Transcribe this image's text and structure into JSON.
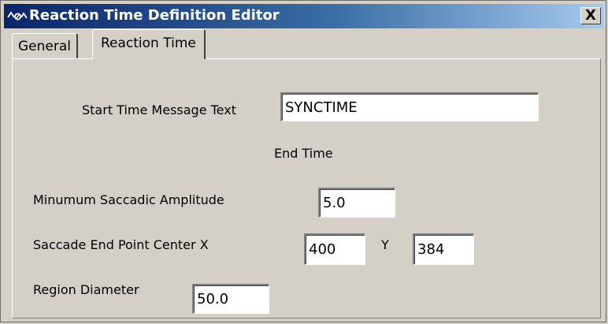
{
  "window": {
    "title": "Reaction Time Definition Editor",
    "close_label": "X",
    "title_gradient": [
      "#0a246a",
      "#a6caf0"
    ]
  },
  "tabs": [
    {
      "label": "General",
      "active": false
    },
    {
      "label": "Reaction Time",
      "active": true
    }
  ],
  "form": {
    "start_time_label": "Start Time Message Text",
    "start_time_value": "SYNCTIME",
    "end_time_heading": "End Time",
    "min_amplitude_label": "Minumum Saccadic Amplitude",
    "min_amplitude_value": "5.0",
    "end_point_label": "Saccade End Point Center X",
    "end_point_x_value": "400",
    "y_label": "Y",
    "end_point_y_value": "384",
    "region_diameter_label": "Region Diameter",
    "region_diameter_value": "50.0"
  }
}
